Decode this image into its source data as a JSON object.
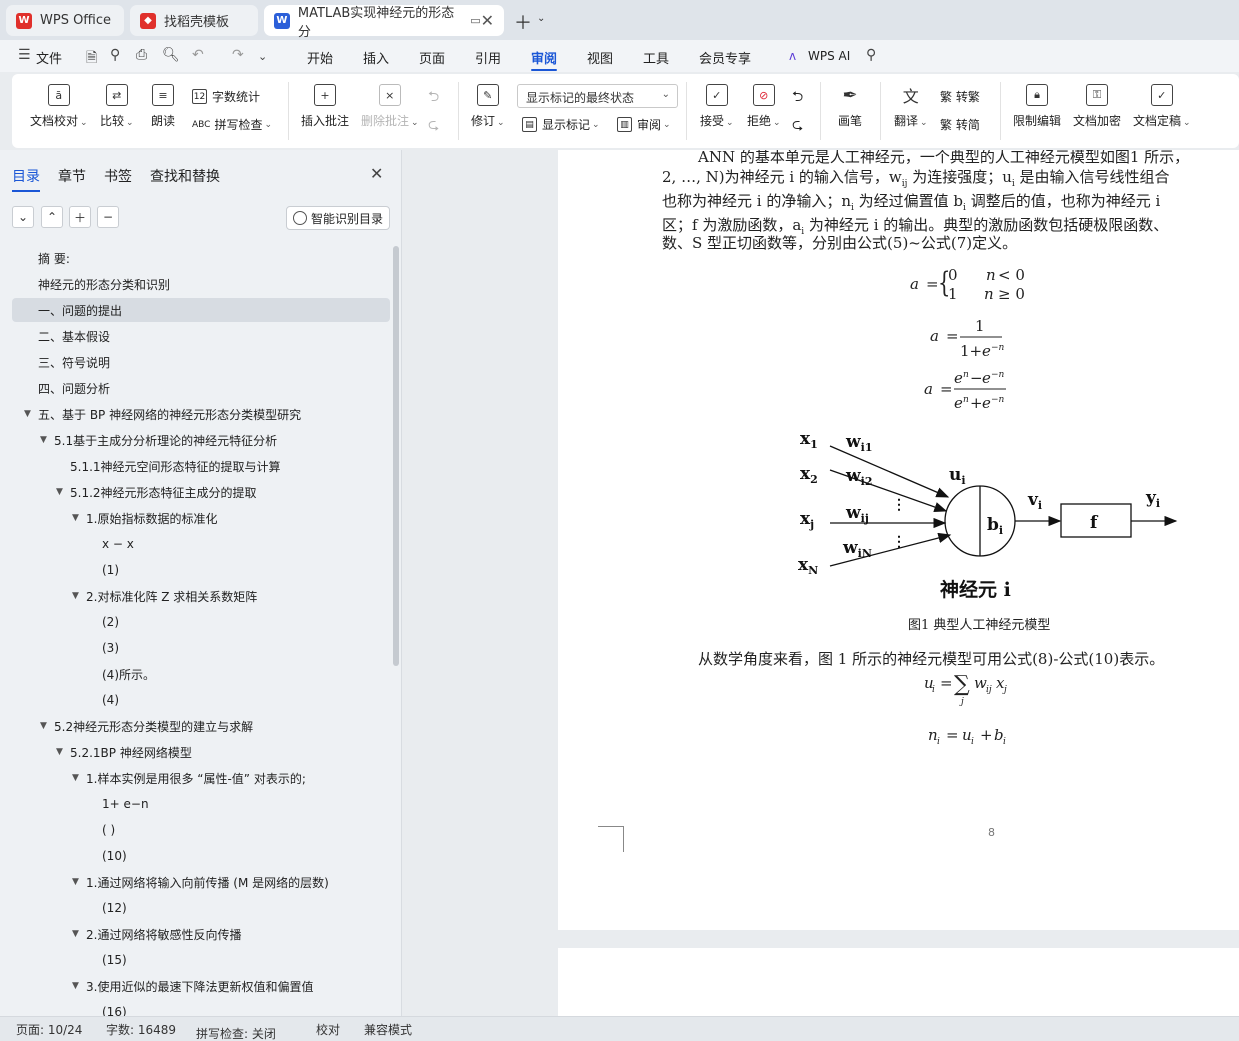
{
  "tabs": [
    {
      "label": "WPS Office",
      "icon": "wps-logo-icon",
      "color": "#e0302b"
    },
    {
      "label": "找稻壳模板",
      "icon": "docer-icon",
      "color": "#e0302b"
    },
    {
      "label": "MATLAB实现神经元的形态分",
      "icon": "word-doc-icon",
      "color": "#2b5fd9"
    }
  ],
  "menu": {
    "file": "文件",
    "items": [
      "开始",
      "插入",
      "页面",
      "引用",
      "审阅",
      "视图",
      "工具",
      "会员专享"
    ],
    "active": "审阅",
    "wps_ai": "WPS AI"
  },
  "ribbon": {
    "doc_proofread": "文档校对",
    "compare": "比较",
    "read_aloud": "朗读",
    "word_count": "字数统计",
    "spell_check": "拼写检查",
    "insert_comment": "插入批注",
    "delete_comment": "删除批注",
    "track": "修订",
    "markup_state": "显示标记的最终状态",
    "show_markup": "显示标记",
    "review": "审阅",
    "accept": "接受",
    "reject": "拒绝",
    "ink": "画笔",
    "translate": "翻译",
    "to_trad": "繁 转繁",
    "to_simp": "繁 转简",
    "restrict_edit": "限制编辑",
    "encrypt": "文档加密",
    "finalize": "文档定稿"
  },
  "sidebar": {
    "tabs": [
      "目录",
      "章节",
      "书签",
      "查找和替换"
    ],
    "smart_toc": "智能识别目录",
    "toc": [
      {
        "text": "摘 要:",
        "level": 0,
        "tri": false
      },
      {
        "text": "神经元的形态分类和识别",
        "level": 0,
        "tri": false
      },
      {
        "text": "一、问题的提出",
        "level": 0,
        "tri": false,
        "sel": true
      },
      {
        "text": "二、基本假设",
        "level": 0,
        "tri": false
      },
      {
        "text": "三、符号说明",
        "level": 0,
        "tri": false
      },
      {
        "text": "四、问题分析",
        "level": 0,
        "tri": false
      },
      {
        "text": "五、基于 BP 神经网络的神经元形态分类模型研究",
        "level": 0,
        "tri": true
      },
      {
        "text": "5.1基于主成分分析理论的神经元特征分析",
        "level": 1,
        "tri": true
      },
      {
        "text": "5.1.1神经元空间形态特征的提取与计算",
        "level": 2,
        "tri": false
      },
      {
        "text": "5.1.2神经元形态特征主成分的提取",
        "level": 2,
        "tri": true
      },
      {
        "text": "1.原始指标数据的标准化",
        "level": 3,
        "tri": true
      },
      {
        "text": "x − x",
        "level": 4,
        "tri": false
      },
      {
        "text": "(1)",
        "level": 4,
        "tri": false
      },
      {
        "text": "2.对标准化阵 Z 求相关系数矩阵",
        "level": 3,
        "tri": true
      },
      {
        "text": "(2)",
        "level": 4,
        "tri": false
      },
      {
        "text": "(3)",
        "level": 4,
        "tri": false
      },
      {
        "text": "(4)所示。",
        "level": 4,
        "tri": false
      },
      {
        "text": "(4)",
        "level": 4,
        "tri": false
      },
      {
        "text": "5.2神经元形态分类模型的建立与求解",
        "level": 1,
        "tri": true
      },
      {
        "text": "5.2.1BP 神经网络模型",
        "level": 2,
        "tri": true
      },
      {
        "text": "1.样本实例是用很多 “属性-值” 对表示的;",
        "level": 3,
        "tri": true
      },
      {
        "text": "1+ e−n",
        "level": 4,
        "tri": false
      },
      {
        "text": "( )",
        "level": 4,
        "tri": false
      },
      {
        "text": "(10)",
        "level": 4,
        "tri": false
      },
      {
        "text": "1.通过网络将输入向前传播 (M 是网络的层数)",
        "level": 3,
        "tri": true
      },
      {
        "text": "(12)",
        "level": 4,
        "tri": false
      },
      {
        "text": "2.通过网络将敏感性反向传播",
        "level": 3,
        "tri": true
      },
      {
        "text": "(15)",
        "level": 4,
        "tri": false
      },
      {
        "text": "3.使用近似的最速下降法更新权值和偏置值",
        "level": 3,
        "tri": true
      },
      {
        "text": "(16)",
        "level": 4,
        "tri": false
      }
    ]
  },
  "document": {
    "line1": "ANN 的基本单元是人工神经元，一个典型的人工神经元模型如图1 所示，",
    "line2": "2, …, N)为神经元 i 的输入信号，w",
    "line2_sub": "ij",
    "line2b": " 为连接强度；u",
    "line2b_sub": "i",
    "line2c": " 是由输入信号线性组合",
    "line3": "也称为神经元 i 的净输入；n",
    "line3_sub": "i",
    "line3b": " 为经过偏置值 b",
    "line3b_sub": "i",
    "line3c": " 调整后的值，也称为神经元 i",
    "line4": "区；f 为激励函数，a",
    "line4_sub": "i",
    "line4b": " 为神经元 i 的输出。典型的激励函数包括硬极限函数、",
    "line5": "数、S 型正切函数等，分别由公式(5)~公式(7)定义。",
    "figure": {
      "inputs": [
        "x1",
        "x2",
        "xj",
        "xN"
      ],
      "weights": [
        "wi1",
        "wi2",
        "wij",
        "wiN"
      ],
      "u_label": "ui",
      "b_label": "bi",
      "v_label": "vi",
      "f_label": "f",
      "y_label": "yi",
      "neuron_label": "神经元 i",
      "caption": "图1 典型人工神经元模型"
    },
    "para2": "从数学角度来看，图 1 所示的神经元模型可用公式(8)-公式(10)表示。",
    "page_number": "8"
  },
  "status": {
    "page": "页面: 10/24",
    "words": "字数: 16489",
    "spell": "拼写检查: 关闭",
    "proof": "校对",
    "compat": "兼容模式"
  }
}
